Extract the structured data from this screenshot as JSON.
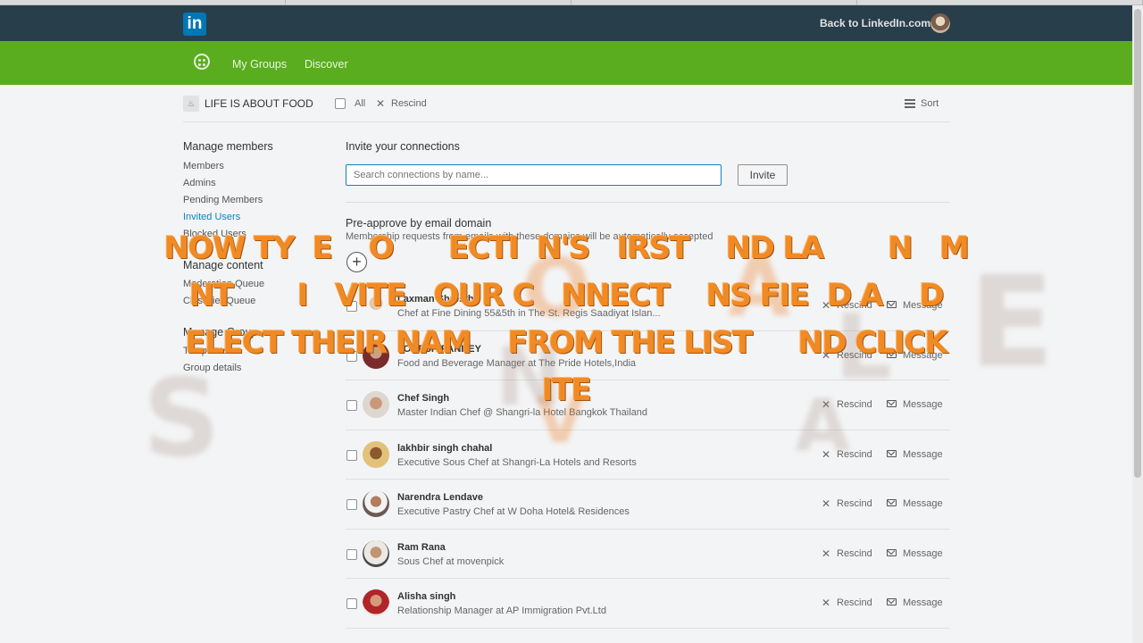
{
  "header": {
    "logo": "in",
    "back_link": "Back to LinkedIn.com"
  },
  "subnav": {
    "my_groups": "My Groups",
    "discover": "Discover"
  },
  "filter_bar": {
    "group_name": "LIFE IS ABOUT FOOD",
    "all_label": "All",
    "rescind_label": "Rescind",
    "sort_label": "Sort"
  },
  "sidebar": {
    "manage_members": {
      "heading": "Manage members",
      "items": [
        "Members",
        "Admins",
        "Pending Members",
        "Invited Users",
        "Blocked Users"
      ]
    },
    "manage_content": {
      "heading": "Manage content",
      "items": [
        "Moderation Queue",
        "Classifier Queue"
      ]
    },
    "manage_group": {
      "heading": "Manage Group",
      "items": [
        "Templates",
        "Group details"
      ]
    },
    "active_item": "Invited Users"
  },
  "invite": {
    "title": "Invite your connections",
    "search_placeholder": "Search connections by name...",
    "invite_button": "Invite"
  },
  "preapprove": {
    "title": "Pre-approve by email domain",
    "subtitle": "Membership requests from emails with these domains will be automatically accepted"
  },
  "row_actions": {
    "rescind": "Rescind",
    "message": "Message"
  },
  "invited_users": [
    {
      "name": "Laxman Shrestha",
      "headline": "Chef at Fine Dining 55&5th in The St. Regis Saadiyat Islan..."
    },
    {
      "name": "LOKESH PANDEY",
      "headline": "Food and Beverage Manager at The Pride Hotels,India"
    },
    {
      "name": "Chef Singh",
      "headline": "Master Indian Chef @ Shangri-la Hotel Bangkok Thailand"
    },
    {
      "name": "lakhbir singh chahal",
      "headline": "Executive Sous Chef at Shangri-La Hotels and Resorts"
    },
    {
      "name": "Narendra Lendave",
      "headline": "Executive Pastry Chef at W Doha Hotel& Residences"
    },
    {
      "name": "Ram Rana",
      "headline": "Sous Chef at movenpick"
    },
    {
      "name": "Alisha singh",
      "headline": "Relationship Manager at AP Immigration Pvt.Ltd"
    }
  ],
  "overlay_caption": {
    "line1": "NOW TY  E    O      ECTI  N'S   IRST    ND LA       N   M",
    "line2": "NT       I   VITE   OUR C   NNECT    NS FIE  D A    D",
    "line3": "ELECT THEIR NAM    FROM THE LIST     ND CLICK",
    "line4": "ITE"
  }
}
